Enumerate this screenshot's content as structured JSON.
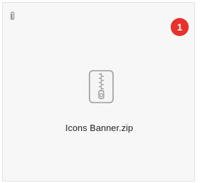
{
  "attachment": {
    "file_name": "Icons Banner.zip",
    "file_icon": "zip-archive-icon",
    "badge_count": "1",
    "badge_color": "#e8302c",
    "attach_icon": "paperclip-icon"
  }
}
